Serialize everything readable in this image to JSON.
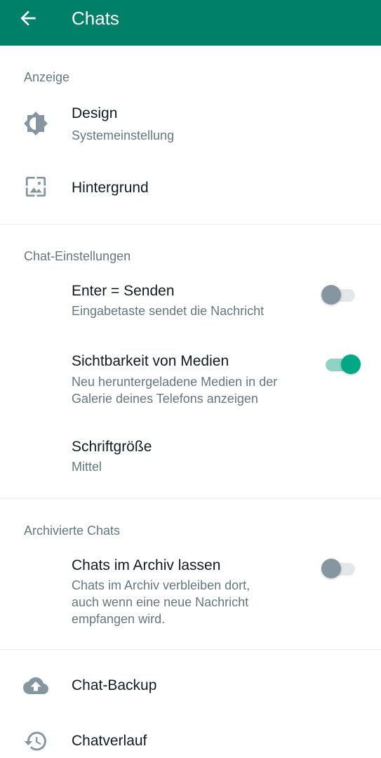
{
  "header": {
    "title": "Chats",
    "back_icon": "arrow-left-icon"
  },
  "sections": {
    "display": {
      "title": "Anzeige",
      "design": {
        "title": "Design",
        "subtitle": "Systemeinstellung",
        "icon": "brightness-icon"
      },
      "wallpaper": {
        "title": "Hintergrund",
        "icon": "wallpaper-icon"
      }
    },
    "chat_settings": {
      "title": "Chat-Einstellungen",
      "enter_send": {
        "title": "Enter = Senden",
        "subtitle": "Eingabetaste sendet die Nachricht",
        "enabled": false
      },
      "media_visibility": {
        "title": "Sichtbarkeit von Medien",
        "subtitle_line1": "Neu heruntergeladene Medien in der",
        "subtitle_line2": "Galerie deines Telefons anzeigen",
        "enabled": true
      },
      "font_size": {
        "title": "Schriftgröße",
        "subtitle": "Mittel"
      }
    },
    "archived": {
      "title": "Archivierte Chats",
      "keep_archived": {
        "title": "Chats im Archiv lassen",
        "subtitle_line1": "Chats im Archiv verbleiben dort,",
        "subtitle_line2": "auch wenn eine neue Nachricht",
        "subtitle_line3": "empfangen wird.",
        "enabled": false
      }
    },
    "more": {
      "backup": {
        "title": "Chat-Backup",
        "icon": "cloud-upload-icon"
      },
      "history": {
        "title": "Chatverlauf",
        "icon": "history-icon"
      }
    }
  },
  "colors": {
    "primary": "#008069",
    "accent": "#00a884",
    "secondary_text": "#667781",
    "icon": "#8696a0"
  }
}
